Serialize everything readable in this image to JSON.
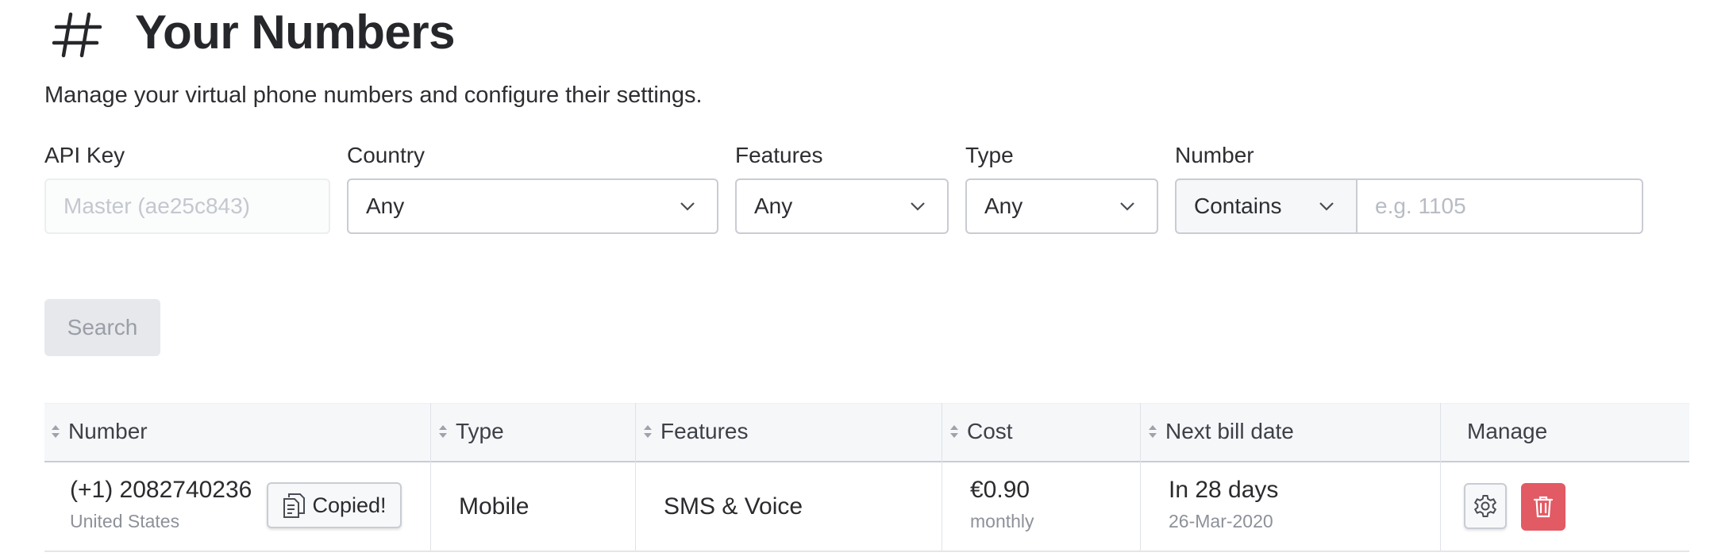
{
  "header": {
    "title": "Your Numbers",
    "subtitle": "Manage your virtual phone numbers and configure their settings."
  },
  "filters": {
    "api_key": {
      "label": "API Key",
      "placeholder": "Master (ae25c843)"
    },
    "country": {
      "label": "Country",
      "value": "Any"
    },
    "features": {
      "label": "Features",
      "value": "Any"
    },
    "type": {
      "label": "Type",
      "value": "Any"
    },
    "number": {
      "label": "Number",
      "match_mode": "Contains",
      "placeholder": "e.g. 1105"
    },
    "search_label": "Search"
  },
  "table": {
    "columns": [
      "Number",
      "Type",
      "Features",
      "Cost",
      "Next bill date",
      "Manage"
    ],
    "rows": [
      {
        "number": "(+1) 2082740236",
        "country": "United States",
        "copy_label": "Copied!",
        "type": "Mobile",
        "features": "SMS & Voice",
        "cost": "€0.90",
        "cost_period": "monthly",
        "next_bill": "In 28 days",
        "next_bill_date": "26-Mar-2020"
      }
    ]
  },
  "icons": {
    "title": "hash-icon",
    "copy": "clipboard-icon",
    "manage": "gear-icon",
    "delete": "trash-icon"
  },
  "colors": {
    "delete_button": "#e25a64",
    "disabled_button": "#e6e8ec",
    "header_bg": "#f5f7f9"
  }
}
